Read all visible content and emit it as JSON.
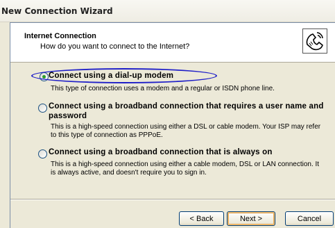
{
  "window": {
    "title": "New Connection Wizard"
  },
  "header": {
    "title": "Internet Connection",
    "subtitle": "How do you want to connect to the Internet?",
    "icon": "phone-connection-icon"
  },
  "options": [
    {
      "label": "Connect using a dial-up modem",
      "description": "This type of connection uses a modem and a regular or ISDN phone line.",
      "selected": true
    },
    {
      "label": "Connect using a broadband connection that requires a user name and password",
      "description": "This is a high-speed connection using either a DSL or cable modem. Your ISP may refer to this type of connection as PPPoE.",
      "selected": false
    },
    {
      "label": "Connect using a broadband connection that is always on",
      "description": "This is a high-speed connection using either a cable modem, DSL or LAN connection. It is always active, and doesn't require you to sign in.",
      "selected": false
    }
  ],
  "buttons": {
    "back": "< Back",
    "next": "Next >",
    "cancel": "Cancel"
  },
  "colors": {
    "highlight": "#1e1ec8",
    "radio_selected": "#2b9a2b"
  }
}
